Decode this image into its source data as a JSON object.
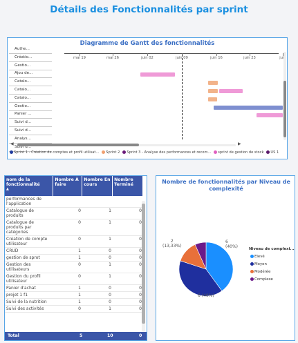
{
  "page_title": "Détails des Fonctionnalités par sprint",
  "gantt": {
    "title": "Diagramme de Gantt des fonctionnalités",
    "rows": [
      "Authe...",
      "Créatio...",
      "Gestio...",
      "Ajou de...",
      "Catalo...",
      "Catalo...",
      "Catalo...",
      "Gestio...",
      "Panier ...",
      "Suivi d...",
      "Suivi d...",
      "Analys...",
      "Suivi d..."
    ],
    "ticks": [
      "mai 19",
      "mai 26",
      "juin 02",
      "juin 09",
      "juin 16",
      "juin 23",
      "juin"
    ],
    "legend": [
      {
        "label": "Sprint 1 - Création de comptes et profil utilisat...",
        "color": "#1f3b9e"
      },
      {
        "label": "Sprint 2",
        "color": "#f0a070"
      },
      {
        "label": "Sprint 3 - Analyse des performances et recom...",
        "color": "#6b1a7a"
      },
      {
        "label": "sprint de gestion de stock",
        "color": "#e060c0"
      },
      {
        "label": "US 1",
        "color": "#5a1a6a"
      }
    ],
    "bar_colors": {
      "pink": "#ef9ad7",
      "orange": "#f2b38a",
      "blue": "#7e8fd0"
    }
  },
  "table": {
    "headers": [
      "nom de la fonctionnalité",
      "Nombre À faire",
      "Nombre En cours",
      "Nombre Terminé"
    ],
    "rows": [
      [
        "performances de l'application",
        "",
        "",
        ""
      ],
      [
        "Catalogue de produits",
        "0",
        "1",
        "0"
      ],
      [
        "Catalogue de produits par catégories",
        "0",
        "1",
        "0"
      ],
      [
        "Création de compte utilisateur",
        "0",
        "1",
        "0"
      ],
      [
        "CRUD",
        "1",
        "0",
        "0"
      ],
      [
        "gestion de sprot",
        "1",
        "0",
        "0"
      ],
      [
        "Gestion des utilisateurs",
        "0",
        "1",
        "0"
      ],
      [
        "Gestion du profil utilisateur",
        "0",
        "1",
        "0"
      ],
      [
        "Panier d'achat",
        "1",
        "0",
        "0"
      ],
      [
        "projet 1 f1",
        "1",
        "0",
        "0"
      ],
      [
        "Suivi de la nutrition",
        "1",
        "0",
        "0"
      ],
      [
        "Suivi des activités",
        "0",
        "1",
        "0"
      ]
    ],
    "total": [
      "Total",
      "5",
      "10",
      "0"
    ]
  },
  "pie": {
    "title": "Nombre de fonctionnalités par Niveau de complexité",
    "legend_title": "Niveau de complexi...",
    "slices": [
      {
        "label": "Elevé",
        "value": 6,
        "pct": "(40%)",
        "color": "#1a8fff"
      },
      {
        "label": "Moyen",
        "value": 6,
        "pct": "(40%)",
        "color": "#1f2f9e"
      },
      {
        "label": "Modérée",
        "value": 2,
        "pct": "(13,33%)",
        "color": "#e8703a"
      },
      {
        "label": "Complexe",
        "value": 1,
        "pct": "",
        "color": "#6b1a8a"
      }
    ]
  }
}
